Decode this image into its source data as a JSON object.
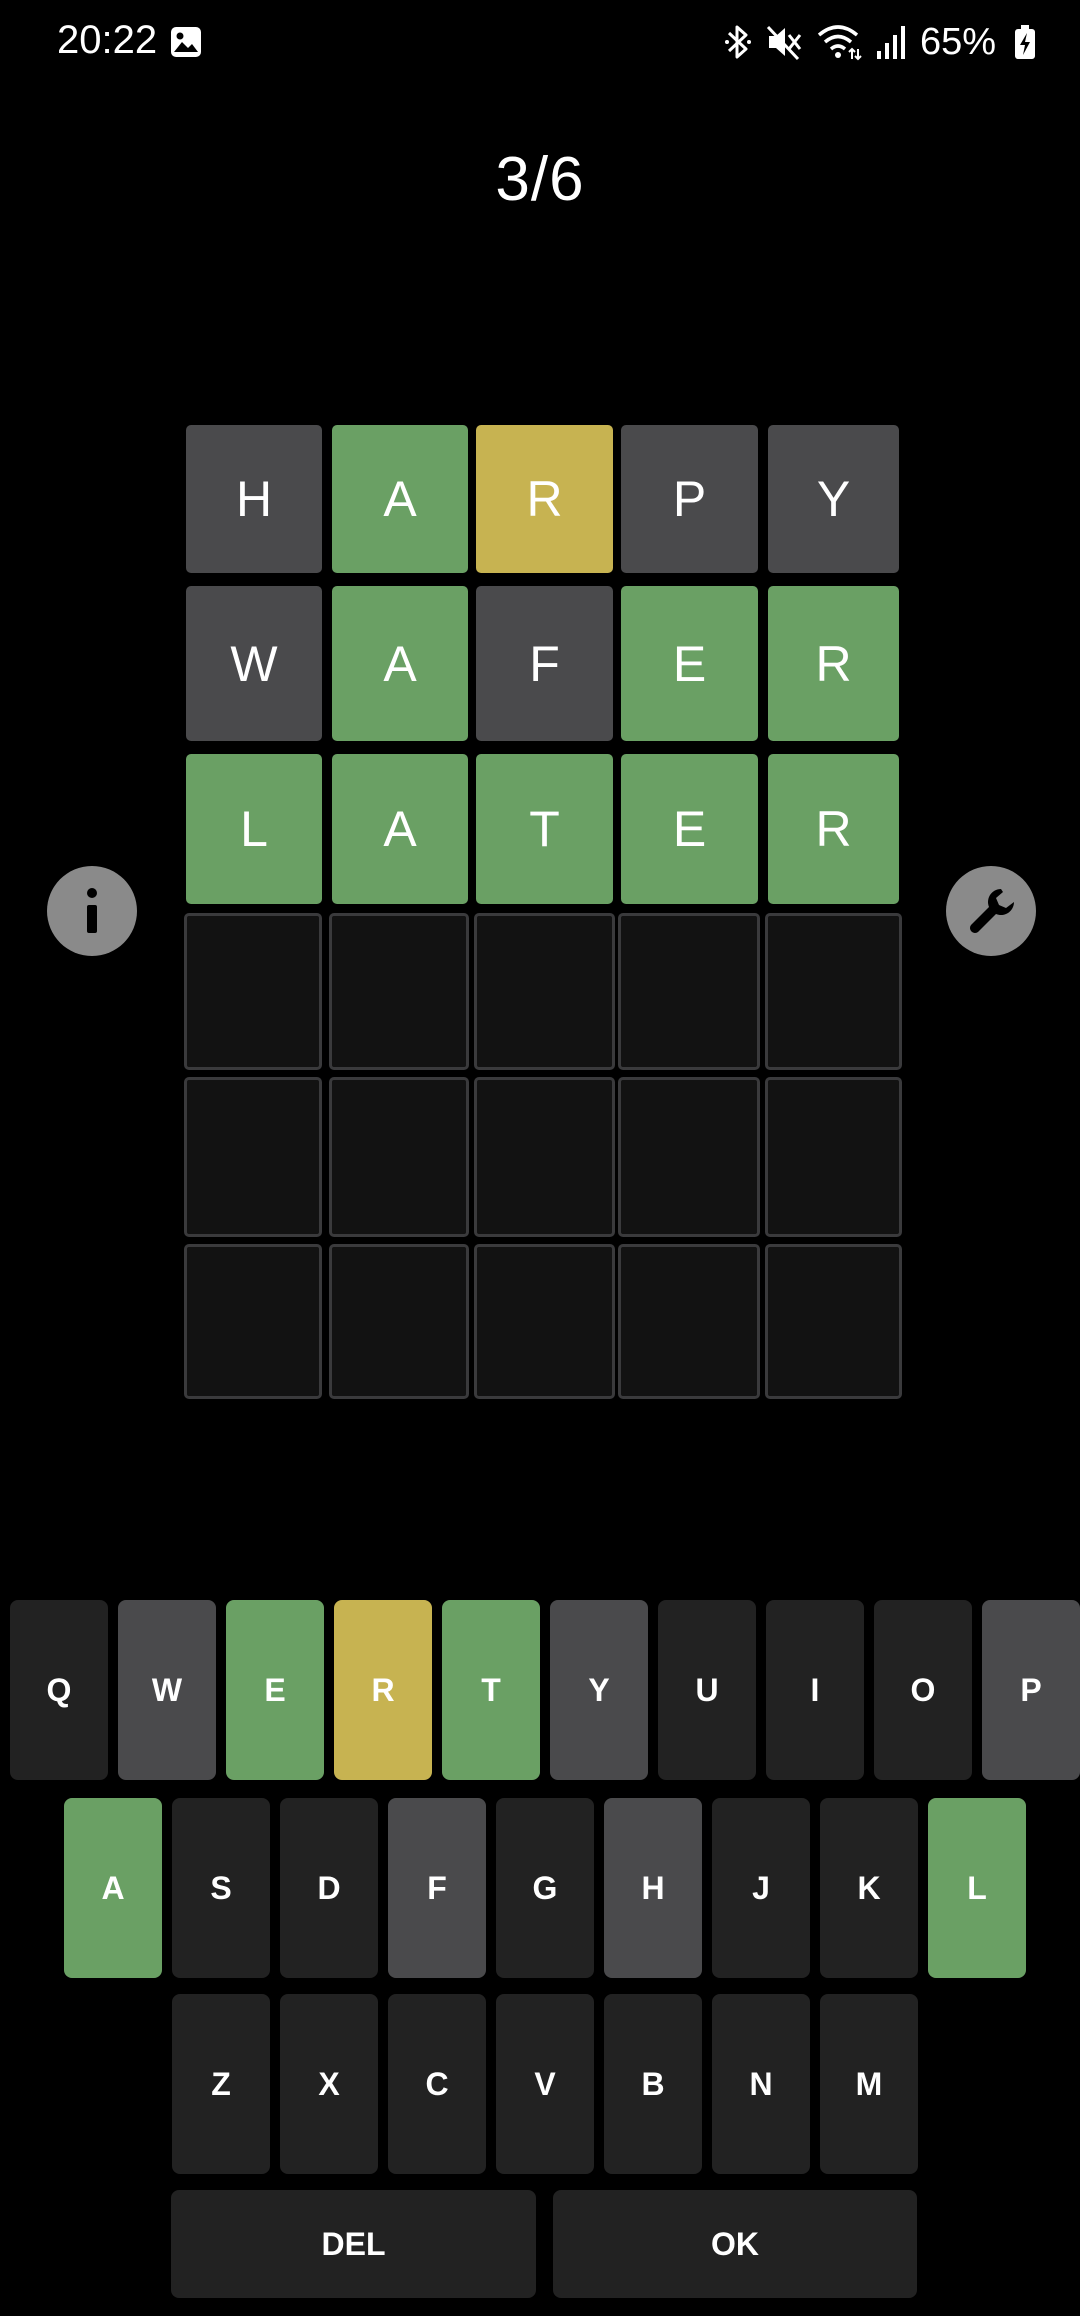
{
  "status_bar": {
    "time": "20:22",
    "battery": "65%",
    "icons": [
      "gallery-icon",
      "bluetooth-icon",
      "mute-icon",
      "wifi-icon",
      "signal-icon",
      "battery-charging-icon"
    ]
  },
  "header": {
    "score": "3/6"
  },
  "colors": {
    "correct": "#6aa064",
    "present": "#c7b351",
    "absent": "#4a4a4c",
    "unused_key": "#222222",
    "empty_tile": "#121212",
    "background": "#000000"
  },
  "board": {
    "rows": [
      {
        "tiles": [
          {
            "letter": "H",
            "state": "absent"
          },
          {
            "letter": "A",
            "state": "correct"
          },
          {
            "letter": "R",
            "state": "present"
          },
          {
            "letter": "P",
            "state": "absent"
          },
          {
            "letter": "Y",
            "state": "absent"
          }
        ]
      },
      {
        "tiles": [
          {
            "letter": "W",
            "state": "absent"
          },
          {
            "letter": "A",
            "state": "correct"
          },
          {
            "letter": "F",
            "state": "absent"
          },
          {
            "letter": "E",
            "state": "correct"
          },
          {
            "letter": "R",
            "state": "correct"
          }
        ]
      },
      {
        "tiles": [
          {
            "letter": "L",
            "state": "correct"
          },
          {
            "letter": "A",
            "state": "correct"
          },
          {
            "letter": "T",
            "state": "correct"
          },
          {
            "letter": "E",
            "state": "correct"
          },
          {
            "letter": "R",
            "state": "correct"
          }
        ]
      },
      {
        "tiles": [
          {
            "letter": "",
            "state": "empty"
          },
          {
            "letter": "",
            "state": "empty"
          },
          {
            "letter": "",
            "state": "empty"
          },
          {
            "letter": "",
            "state": "empty"
          },
          {
            "letter": "",
            "state": "empty"
          }
        ]
      },
      {
        "tiles": [
          {
            "letter": "",
            "state": "empty"
          },
          {
            "letter": "",
            "state": "empty"
          },
          {
            "letter": "",
            "state": "empty"
          },
          {
            "letter": "",
            "state": "empty"
          },
          {
            "letter": "",
            "state": "empty"
          }
        ]
      },
      {
        "tiles": [
          {
            "letter": "",
            "state": "empty"
          },
          {
            "letter": "",
            "state": "empty"
          },
          {
            "letter": "",
            "state": "empty"
          },
          {
            "letter": "",
            "state": "empty"
          },
          {
            "letter": "",
            "state": "empty"
          }
        ]
      }
    ]
  },
  "side_buttons": {
    "left": "info-icon",
    "right": "wrench-icon"
  },
  "keyboard": {
    "rows": [
      [
        {
          "label": "Q",
          "state": "unused"
        },
        {
          "label": "W",
          "state": "absent"
        },
        {
          "label": "E",
          "state": "correct"
        },
        {
          "label": "R",
          "state": "present"
        },
        {
          "label": "T",
          "state": "correct"
        },
        {
          "label": "Y",
          "state": "absent"
        },
        {
          "label": "U",
          "state": "unused"
        },
        {
          "label": "I",
          "state": "unused"
        },
        {
          "label": "O",
          "state": "unused"
        },
        {
          "label": "P",
          "state": "absent"
        }
      ],
      [
        {
          "label": "A",
          "state": "correct"
        },
        {
          "label": "S",
          "state": "unused"
        },
        {
          "label": "D",
          "state": "unused"
        },
        {
          "label": "F",
          "state": "absent"
        },
        {
          "label": "G",
          "state": "unused"
        },
        {
          "label": "H",
          "state": "absent"
        },
        {
          "label": "J",
          "state": "unused"
        },
        {
          "label": "K",
          "state": "unused"
        },
        {
          "label": "L",
          "state": "correct"
        }
      ],
      [
        {
          "label": "Z",
          "state": "unused"
        },
        {
          "label": "X",
          "state": "unused"
        },
        {
          "label": "C",
          "state": "unused"
        },
        {
          "label": "V",
          "state": "unused"
        },
        {
          "label": "B",
          "state": "unused"
        },
        {
          "label": "N",
          "state": "unused"
        },
        {
          "label": "M",
          "state": "unused"
        }
      ]
    ],
    "actions": {
      "delete_label": "DEL",
      "ok_label": "OK"
    }
  }
}
